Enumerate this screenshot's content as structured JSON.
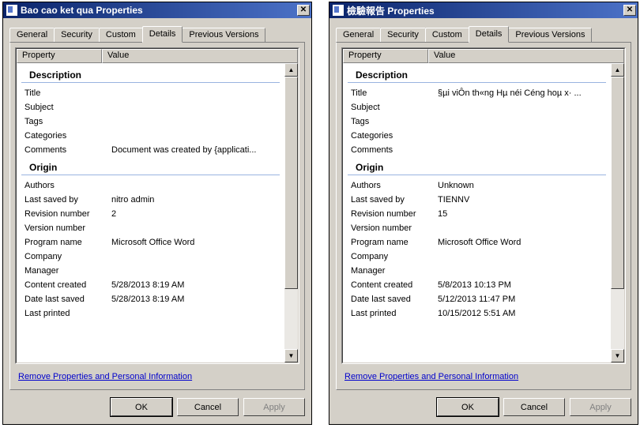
{
  "tabs": [
    "General",
    "Security",
    "Custom",
    "Details",
    "Previous Versions"
  ],
  "active_tab": "Details",
  "list_headers": {
    "property": "Property",
    "value": "Value"
  },
  "groups": {
    "description": "Description",
    "origin": "Origin"
  },
  "desc_labels": {
    "title": "Title",
    "subject": "Subject",
    "tags": "Tags",
    "categories": "Categories",
    "comments": "Comments"
  },
  "origin_labels": {
    "authors": "Authors",
    "last_saved_by": "Last saved by",
    "revision_number": "Revision number",
    "version_number": "Version number",
    "program_name": "Program name",
    "company": "Company",
    "manager": "Manager",
    "content_created": "Content created",
    "date_last_saved": "Date last saved",
    "last_printed": "Last printed"
  },
  "link_text": "Remove Properties and Personal Information",
  "buttons": {
    "ok": "OK",
    "cancel": "Cancel",
    "apply": "Apply"
  },
  "windows": {
    "left": {
      "title": "Bao cao ket qua Properties",
      "description": {
        "title": "",
        "subject": "",
        "tags": "",
        "categories": "",
        "comments": "Document was created by {applicati..."
      },
      "origin": {
        "authors": "",
        "last_saved_by": "nitro admin",
        "revision_number": "2",
        "version_number": "",
        "program_name": "Microsoft Office Word",
        "company": "",
        "manager": "",
        "content_created": "5/28/2013 8:19 AM",
        "date_last_saved": "5/28/2013 8:19 AM",
        "last_printed": ""
      }
    },
    "right": {
      "title": "檢驗報告 Properties",
      "description": {
        "title": "§µi viÔn th«ng Hµ néi  Céng hoµ x· ...",
        "subject": "",
        "tags": "",
        "categories": "",
        "comments": ""
      },
      "origin": {
        "authors": "Unknown",
        "last_saved_by": "TIENNV",
        "revision_number": "15",
        "version_number": "",
        "program_name": "Microsoft Office Word",
        "company": "",
        "manager": "",
        "content_created": "5/8/2013 10:13 PM",
        "date_last_saved": "5/12/2013 11:47 PM",
        "last_printed": "10/15/2012 5:51 AM"
      }
    }
  }
}
